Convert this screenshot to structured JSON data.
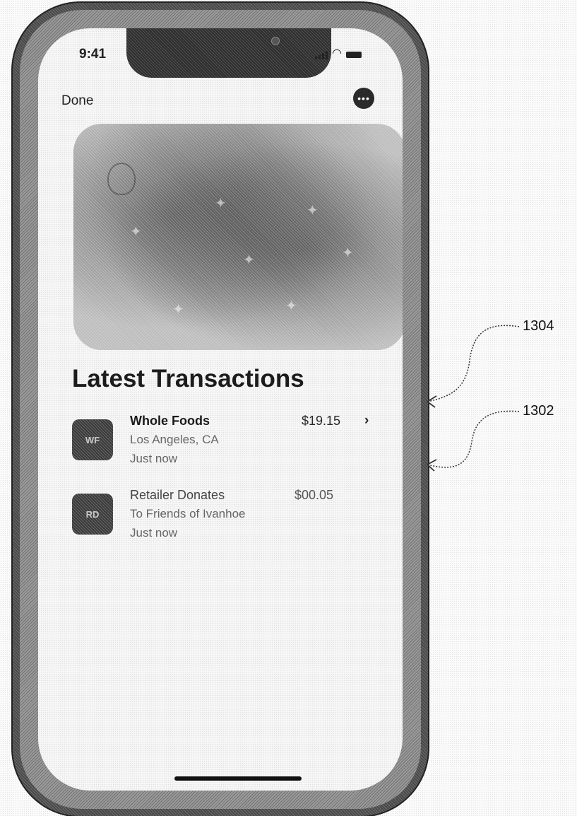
{
  "status_bar": {
    "time": "9:41"
  },
  "nav": {
    "done_label": "Done",
    "more_label": "•••"
  },
  "section": {
    "title": "Latest Transactions"
  },
  "transactions": [
    {
      "name": "Whole Foods",
      "location": "Los Angeles, CA",
      "time": "Just now",
      "amount": "$19.15",
      "icon_text": "WF",
      "has_chevron": true
    },
    {
      "name": "Retailer Donates",
      "location": "To Friends of Ivanhoe",
      "time": "Just now",
      "amount": "$00.05",
      "icon_text": "RD",
      "has_chevron": false
    }
  ],
  "transaction_chevron": "›",
  "callouts": {
    "list_ref": "1304",
    "row_ref": "1302"
  }
}
